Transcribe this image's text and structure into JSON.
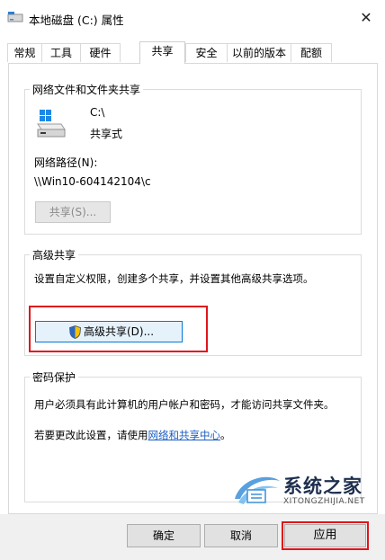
{
  "window": {
    "title": "本地磁盘 (C:) 属性"
  },
  "tabs": [
    {
      "label": "常规"
    },
    {
      "label": "工具"
    },
    {
      "label": "硬件"
    },
    {
      "label": "共享"
    },
    {
      "label": "安全"
    },
    {
      "label": "以前的版本"
    },
    {
      "label": "配额"
    }
  ],
  "network_share": {
    "group_title": "网络文件和文件夹共享",
    "drive_name": "C:\\",
    "share_state": "共享式",
    "path_label": "网络路径(N):",
    "path_value": "\\\\Win10-604142104\\c",
    "share_button": "共享(S)..."
  },
  "advanced": {
    "group_title": "高级共享",
    "description": "设置自定义权限，创建多个共享，并设置其他高级共享选项。",
    "button": "高级共享(D)..."
  },
  "password": {
    "group_title": "密码保护",
    "line1": "用户必须具有此计算机的用户帐户和密码，才能访问共享文件夹。",
    "line2_prefix": "若要更改此设置，请使用",
    "link": "网络和共享中心",
    "line2_suffix": "。"
  },
  "watermark": {
    "title": "系统之家",
    "subtitle": "XITONGZHIJIA.NET"
  },
  "footer": {
    "ok": "确定",
    "cancel": "取消",
    "apply": "应用"
  },
  "colors": {
    "highlight_box": "#e0151b",
    "link": "#1a5ec4"
  }
}
